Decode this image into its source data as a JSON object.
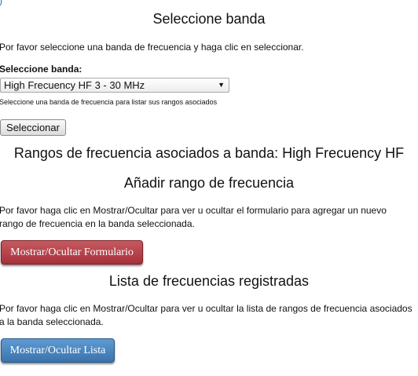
{
  "select_band": {
    "title": "Seleccione banda",
    "instruction": "Por favor seleccione una banda de frecuencia y haga clic en seleccionar.",
    "label": "Seleccione banda:",
    "selected_option": "High Frecuency HF 3 - 30 MHz",
    "hint": "Seleccione una banda de frecuencia para listar sus rangos asociados",
    "button_label": "Seleccionar"
  },
  "ranges_heading": "Rangos de frecuencia asociados a banda: High Frecuency HF",
  "add_range": {
    "title": "Añadir rango de frecuencia",
    "instruction_line1": "Por favor haga clic en Mostrar/Ocultar para ver u ocultar el formulario para agregar un nuevo",
    "instruction_line2": "rango de frecuencia en la banda seleccionada.",
    "button_label": "Mostrar/Ocultar Formulario"
  },
  "registered_list": {
    "title": "Lista de frecuencias registradas",
    "instruction_line1": "Por favor haga clic en Mostrar/Ocultar para ver u ocultar la lista de rangos de frecuencia asociados",
    "instruction_line2": "a la banda seleccionada.",
    "button_label": "Mostrar/Ocultar Lista"
  },
  "colors": {
    "form_button": "#b2434b",
    "list_button": "#4a85c0"
  },
  "icons": {
    "corner": "partial-link-glyph",
    "select_arrow": "triangle-down-icon"
  }
}
